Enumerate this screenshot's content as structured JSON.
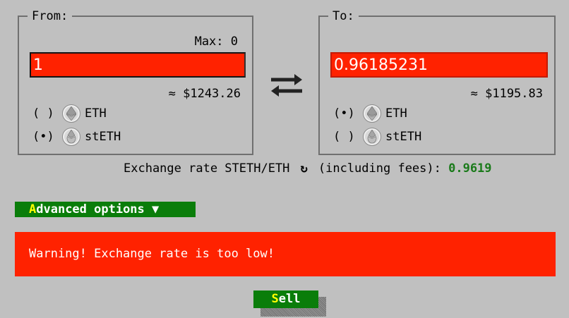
{
  "from": {
    "legend": "From:",
    "max_text": "Max: 0",
    "amount": "1",
    "usd_value": "≈ $1243.26",
    "options": [
      {
        "radio": "( )",
        "token": "ETH",
        "icon": "eth-icon"
      },
      {
        "radio": "(•)",
        "token": "stETH",
        "icon": "steth-icon"
      }
    ]
  },
  "to": {
    "legend": "To:",
    "amount": "0.96185231",
    "usd_value": "≈ $1195.83",
    "options": [
      {
        "radio": "(•)",
        "token": "ETH",
        "icon": "eth-icon"
      },
      {
        "radio": "( )",
        "token": "stETH",
        "icon": "steth-icon"
      }
    ]
  },
  "exchange": {
    "label_before": "Exchange rate STETH/ETH ",
    "refresh_icon": "↻",
    "label_after": " (including fees): ",
    "value": "0.9619"
  },
  "advanced": {
    "hotkey": "A",
    "rest": "dvanced options ▼"
  },
  "warning": "Warning! Exchange rate is too low!",
  "sell": {
    "hotkey": "S",
    "rest": "ell"
  },
  "colors": {
    "background": "#c0c0c0",
    "input_error": "#ff2200",
    "button_green": "#0a7d0a",
    "rate_green": "#1a7a1a",
    "hotkey_yellow": "#ffff00"
  }
}
